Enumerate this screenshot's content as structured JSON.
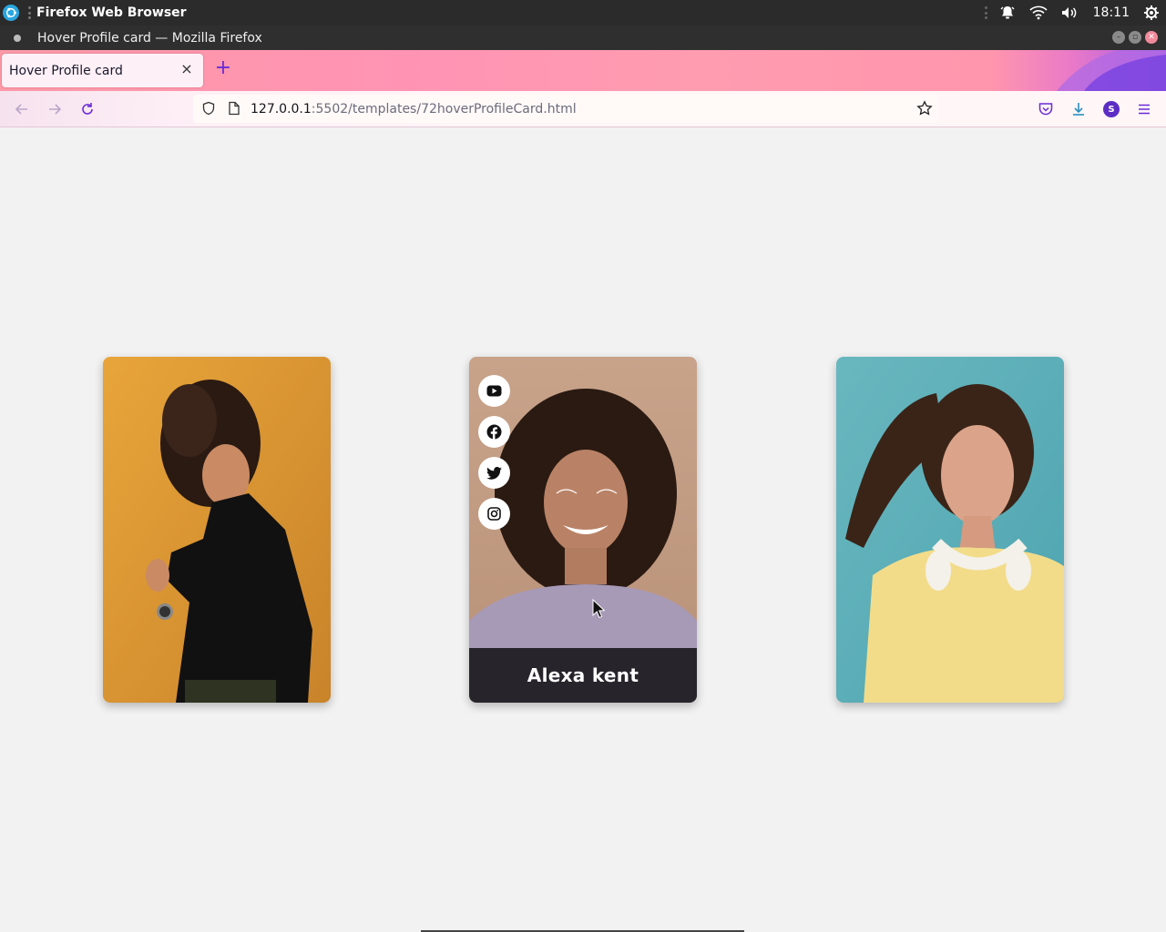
{
  "system_bar": {
    "app_name": "Firefox Web Browser",
    "clock": "18:11",
    "icons": [
      "notifications-icon",
      "wifi-icon",
      "volume-icon",
      "settings-icon"
    ]
  },
  "window": {
    "title": "Hover Profile card — Mozilla Firefox"
  },
  "browser": {
    "tab_title": "Hover Profile card",
    "url_host": "127.0.0.1",
    "url_path": ":5502/templates/72hoverProfileCard.html",
    "new_tab_symbol": "+",
    "close_symbol": "×",
    "account_initial": "S",
    "colors": {
      "tab_gradient_start": "#ff9aa8",
      "tab_gradient_end": "#a45be8",
      "accent": "#6b2bd6"
    }
  },
  "page": {
    "background": "#f2f2f2",
    "cards": [
      {
        "photo": "woman with curly hair in black turtleneck on yellow-orange background",
        "bg": "#e3a437"
      },
      {
        "photo": "smiling woman with curly hair in lavender sweater on beige background",
        "bg": "#c49c80",
        "name": "Alexa kent",
        "social_icons": [
          "youtube-icon",
          "facebook-icon",
          "twitter-icon",
          "instagram-icon"
        ]
      },
      {
        "photo": "woman with flowing hair and headphones in yellow t-shirt on teal background",
        "bg": "#5aadb8"
      }
    ]
  }
}
